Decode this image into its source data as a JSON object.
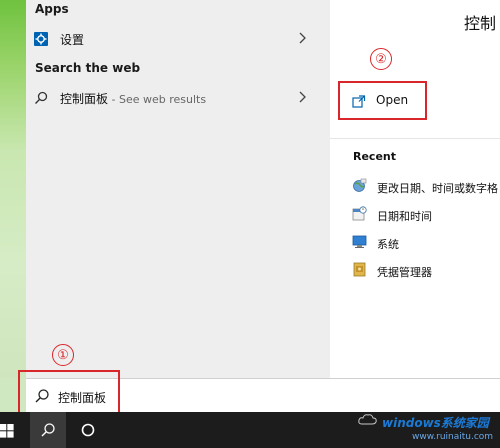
{
  "results": {
    "apps_heading": "Apps",
    "apps_items": [
      {
        "label": "设置",
        "icon": "settings-gear-icon"
      }
    ],
    "web_heading": "Search the web",
    "web_items": [
      {
        "label": "控制面板",
        "sub": " - See web results",
        "icon": "search-icon"
      }
    ]
  },
  "detail": {
    "title": "控制",
    "open_label": "Open",
    "recent_heading": "Recent",
    "recent_items": [
      {
        "label": "更改日期、时间或数字格",
        "icon": "region-globe-icon"
      },
      {
        "label": "日期和时间",
        "icon": "date-time-icon"
      },
      {
        "label": "系统",
        "icon": "monitor-icon"
      },
      {
        "label": "凭据管理器",
        "icon": "credential-manager-icon"
      }
    ]
  },
  "annotations": {
    "step1": "①",
    "step2": "②"
  },
  "search": {
    "query": "控制面板"
  },
  "watermark": {
    "brand": "windows系统家园",
    "url": "www.ruinaitu.com"
  },
  "colors": {
    "annotation_red": "#d9262b",
    "accent_blue": "#0063b1",
    "taskbar": "#1c1c1c"
  }
}
